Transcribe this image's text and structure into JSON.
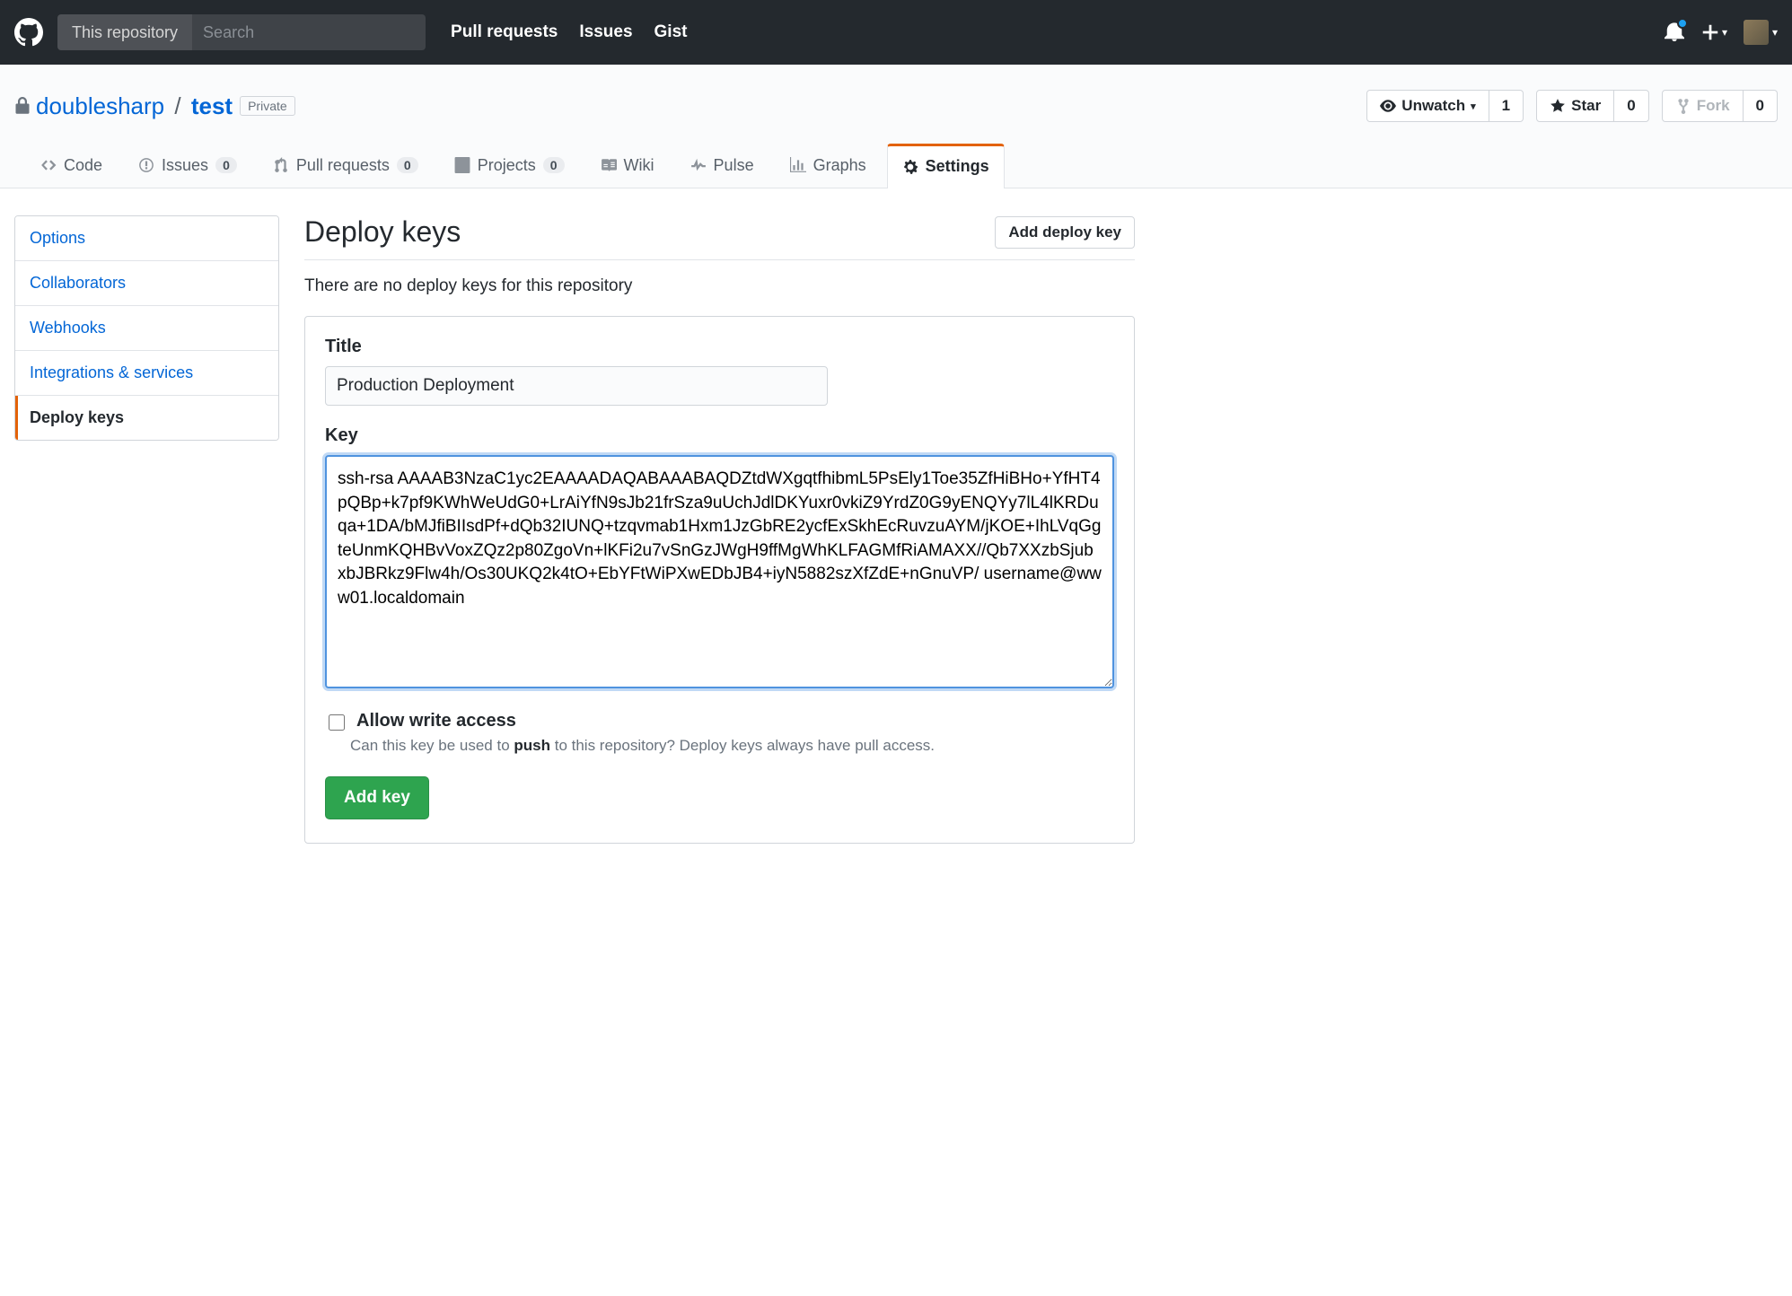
{
  "topbar": {
    "search_scope": "This repository",
    "search_placeholder": "Search",
    "nav": {
      "pull_requests": "Pull requests",
      "issues": "Issues",
      "gist": "Gist"
    }
  },
  "repo": {
    "owner": "doublesharp",
    "name": "test",
    "privacy_label": "Private"
  },
  "pagehead_actions": {
    "unwatch_label": "Unwatch",
    "unwatch_count": "1",
    "star_label": "Star",
    "star_count": "0",
    "fork_label": "Fork",
    "fork_count": "0"
  },
  "tabs": {
    "code": "Code",
    "issues": "Issues",
    "issues_count": "0",
    "pr": "Pull requests",
    "pr_count": "0",
    "projects": "Projects",
    "projects_count": "0",
    "wiki": "Wiki",
    "pulse": "Pulse",
    "graphs": "Graphs",
    "settings": "Settings"
  },
  "menu": {
    "options": "Options",
    "collaborators": "Collaborators",
    "webhooks": "Webhooks",
    "integrations": "Integrations & services",
    "deploy_keys": "Deploy keys"
  },
  "deploy_keys": {
    "heading": "Deploy keys",
    "add_button": "Add deploy key",
    "empty_msg": "There are no deploy keys for this repository",
    "title_label": "Title",
    "title_value": "Production Deployment",
    "key_label": "Key",
    "key_value": "ssh-rsa AAAAB3NzaC1yc2EAAAADAQABAAABAQDZtdWXgqtfhibmL5PsEly1Toe35ZfHiBHo+YfHT4pQBp+k7pf9KWhWeUdG0+LrAiYfN9sJb21frSza9uUchJdlDKYuxr0vkiZ9YrdZ0G9yENQYy7lL4lKRDuqa+1DA/bMJfiBIIsdPf+dQb32IUNQ+tzqvmab1Hxm1JzGbRE2ycfExSkhEcRuvzuAYM/jKOE+IhLVqGgteUnmKQHBvVoxZQz2p80ZgoVn+lKFi2u7vSnGzJWgH9ffMgWhKLFAGMfRiAMAXX//Qb7XXzbSjubxbJBRkz9Flw4h/Os30UKQ2k4tO+EbYFtWiPXwEDbJB4+iyN5882szXfZdE+nGnuVP/ username@www01.localdomain",
    "allow_write_label": "Allow write access",
    "allow_write_note_pre": "Can this key be used to ",
    "allow_write_note_strong": "push",
    "allow_write_note_post": " to this repository? Deploy keys always have pull access.",
    "submit_label": "Add key"
  }
}
